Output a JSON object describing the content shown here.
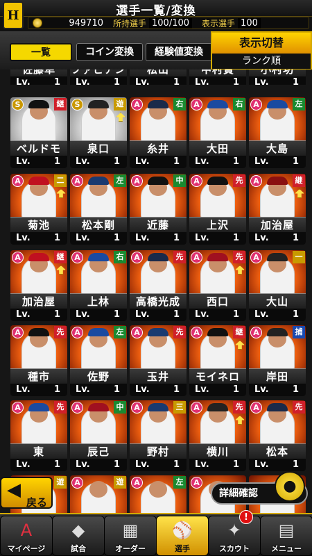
{
  "header": {
    "logo": "H",
    "title": "選手一覧/変換",
    "coins": "949710",
    "owned_label": "所持選手",
    "owned_value": "100/100",
    "shown_label": "表示選手",
    "shown_value": "100"
  },
  "tabs": [
    {
      "label": "一覧",
      "active": true
    },
    {
      "label": "コイン変換",
      "active": false
    },
    {
      "label": "経験値変換",
      "active": false
    }
  ],
  "display_toggle": {
    "title": "表示切替",
    "value": "ランク順"
  },
  "partial_row": [
    {
      "name": "佐藤隼",
      "lv_label": "Lv.",
      "lv": "1"
    },
    {
      "name": "ファビアン",
      "lv_label": "Lv.",
      "lv": "1"
    },
    {
      "name": "松山",
      "lv_label": "Lv.",
      "lv": "1"
    },
    {
      "name": "中村貴",
      "lv_label": "Lv.",
      "lv": "1"
    },
    {
      "name": "小村功",
      "lv_label": "Lv.",
      "lv": "1"
    }
  ],
  "cards": [
    {
      "rank": "S",
      "pos": "継",
      "pos_color": "#d0202a",
      "name": "ベルドモ",
      "lv_label": "Lv.",
      "lv": "1",
      "cap_color": "#111111",
      "up": false
    },
    {
      "rank": "S",
      "pos": "遊",
      "pos_color": "#c89a00",
      "name": "泉口",
      "lv_label": "Lv.",
      "lv": "1",
      "cap_color": "#222222",
      "up": true
    },
    {
      "rank": "A",
      "pos": "右",
      "pos_color": "#1a8a30",
      "name": "糸井",
      "lv_label": "Lv.",
      "lv": "1",
      "cap_color": "#1a2a4a",
      "up": false
    },
    {
      "rank": "A",
      "pos": "右",
      "pos_color": "#1a8a30",
      "name": "大田",
      "lv_label": "Lv.",
      "lv": "1",
      "cap_color": "#1a4aa0",
      "up": false
    },
    {
      "rank": "A",
      "pos": "左",
      "pos_color": "#1a8a30",
      "name": "大島",
      "lv_label": "Lv.",
      "lv": "1",
      "cap_color": "#1a4aa0",
      "up": false
    },
    {
      "rank": "A",
      "pos": "二",
      "pos_color": "#c89a00",
      "name": "菊池",
      "lv_label": "Lv.",
      "lv": "1",
      "cap_color": "#c01020",
      "up": true
    },
    {
      "rank": "A",
      "pos": "左",
      "pos_color": "#1a8a30",
      "name": "松本剛",
      "lv_label": "Lv.",
      "lv": "1",
      "cap_color": "#1a3a70",
      "up": false
    },
    {
      "rank": "A",
      "pos": "中",
      "pos_color": "#1a8a30",
      "name": "近藤",
      "lv_label": "Lv.",
      "lv": "1",
      "cap_color": "#111111",
      "up": false
    },
    {
      "rank": "A",
      "pos": "先",
      "pos_color": "#d0202a",
      "name": "上沢",
      "lv_label": "Lv.",
      "lv": "1",
      "cap_color": "#111111",
      "up": false
    },
    {
      "rank": "A",
      "pos": "継",
      "pos_color": "#d0202a",
      "name": "加治屋",
      "lv_label": "Lv.",
      "lv": "1",
      "cap_color": "#8a1010",
      "up": true
    },
    {
      "rank": "A",
      "pos": "継",
      "pos_color": "#d0202a",
      "name": "加治屋",
      "lv_label": "Lv.",
      "lv": "1",
      "cap_color": "#c01020",
      "up": true
    },
    {
      "rank": "A",
      "pos": "右",
      "pos_color": "#1a8a30",
      "name": "上林",
      "lv_label": "Lv.",
      "lv": "1",
      "cap_color": "#1a4aa0",
      "up": false
    },
    {
      "rank": "A",
      "pos": "先",
      "pos_color": "#d0202a",
      "name": "高橋光成",
      "lv_label": "Lv.",
      "lv": "1",
      "cap_color": "#1a2a4a",
      "up": false
    },
    {
      "rank": "A",
      "pos": "先",
      "pos_color": "#d0202a",
      "name": "西口",
      "lv_label": "Lv.",
      "lv": "1",
      "cap_color": "#a01020",
      "up": true
    },
    {
      "rank": "A",
      "pos": "一",
      "pos_color": "#c89a00",
      "name": "大山",
      "lv_label": "Lv.",
      "lv": "1",
      "cap_color": "#222222",
      "up": false
    },
    {
      "rank": "A",
      "pos": "先",
      "pos_color": "#d0202a",
      "name": "種市",
      "lv_label": "Lv.",
      "lv": "1",
      "cap_color": "#111111",
      "up": false
    },
    {
      "rank": "A",
      "pos": "左",
      "pos_color": "#1a8a30",
      "name": "佐野",
      "lv_label": "Lv.",
      "lv": "1",
      "cap_color": "#1a4aa0",
      "up": false
    },
    {
      "rank": "A",
      "pos": "先",
      "pos_color": "#d0202a",
      "name": "玉井",
      "lv_label": "Lv.",
      "lv": "1",
      "cap_color": "#1a3a70",
      "up": false
    },
    {
      "rank": "A",
      "pos": "継",
      "pos_color": "#d0202a",
      "name": "モイネロ",
      "lv_label": "Lv.",
      "lv": "1",
      "cap_color": "#111111",
      "up": true
    },
    {
      "rank": "A",
      "pos": "捕",
      "pos_color": "#1a4ab0",
      "name": "岸田",
      "lv_label": "Lv.",
      "lv": "1",
      "cap_color": "#222222",
      "up": false
    },
    {
      "rank": "A",
      "pos": "先",
      "pos_color": "#d0202a",
      "name": "東",
      "lv_label": "Lv.",
      "lv": "1",
      "cap_color": "#1a4aa0",
      "up": false
    },
    {
      "rank": "A",
      "pos": "中",
      "pos_color": "#1a8a30",
      "name": "辰己",
      "lv_label": "Lv.",
      "lv": "1",
      "cap_color": "#a01020",
      "up": false
    },
    {
      "rank": "A",
      "pos": "三",
      "pos_color": "#c89a00",
      "name": "野村",
      "lv_label": "Lv.",
      "lv": "1",
      "cap_color": "#1a3a70",
      "up": false
    },
    {
      "rank": "A",
      "pos": "先",
      "pos_color": "#d0202a",
      "name": "横川",
      "lv_label": "Lv.",
      "lv": "1",
      "cap_color": "#222222",
      "up": true
    },
    {
      "rank": "A",
      "pos": "先",
      "pos_color": "#d0202a",
      "name": "松本",
      "lv_label": "Lv.",
      "lv": "1",
      "cap_color": "#1a2a4a",
      "up": false
    }
  ],
  "peek_row": [
    {
      "rank": "",
      "pos": "遊",
      "pos_color": "#c89a00"
    },
    {
      "rank": "A",
      "pos": "遊",
      "pos_color": "#c89a00"
    },
    {
      "rank": "A",
      "pos": "左",
      "pos_color": "#1a8a30"
    },
    {
      "rank": "A",
      "pos": "",
      "pos_color": ""
    },
    {
      "rank": "",
      "pos": "",
      "pos_color": ""
    }
  ],
  "controls": {
    "back_label": "戻る",
    "back_arrow": "◀",
    "detail_label": "詳細確認"
  },
  "nav": [
    {
      "label": "マイページ",
      "icon": "A",
      "active": false
    },
    {
      "label": "試合",
      "icon": "◆",
      "active": false
    },
    {
      "label": "オーダー",
      "icon": "▦",
      "active": false
    },
    {
      "label": "選手",
      "icon": "⚾",
      "active": true
    },
    {
      "label": "スカウト",
      "icon": "✦",
      "active": false
    },
    {
      "label": "メニュー",
      "icon": "▤",
      "active": false
    }
  ],
  "scout_badge": "!"
}
